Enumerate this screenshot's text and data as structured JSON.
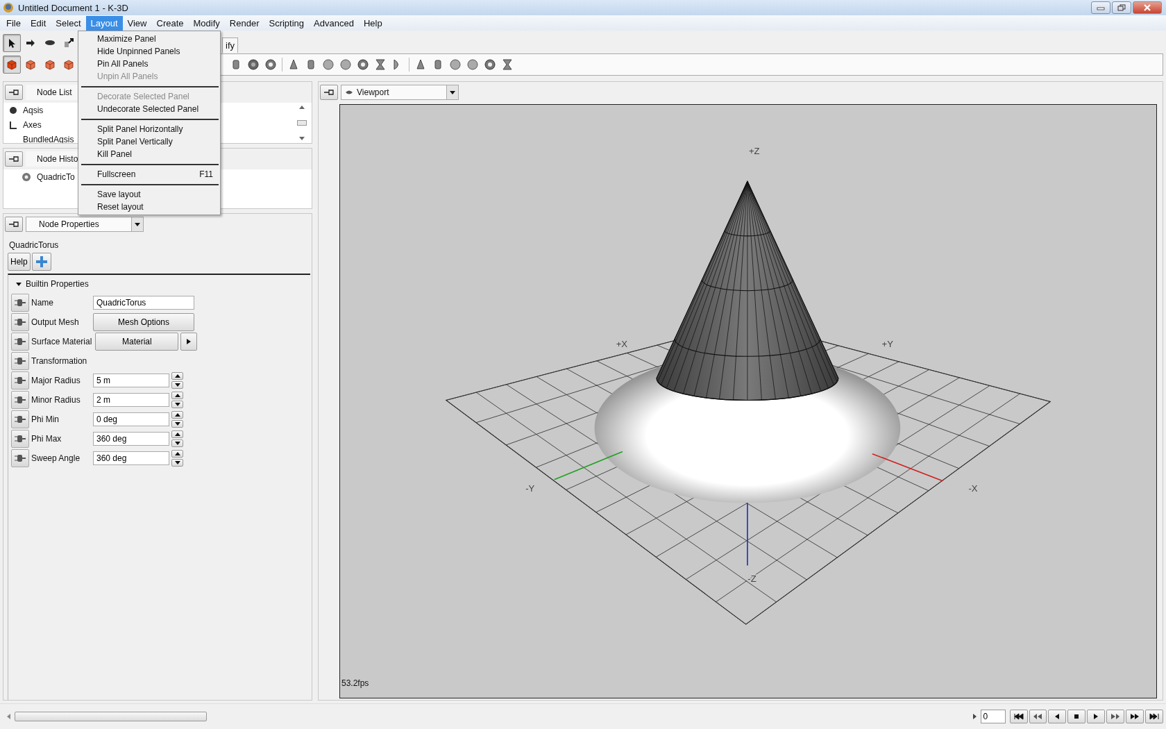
{
  "window": {
    "title": "Untitled Document 1 - K-3D"
  },
  "menu_bar": [
    {
      "label": "File",
      "selected": false
    },
    {
      "label": "Edit",
      "selected": false
    },
    {
      "label": "Select",
      "selected": false
    },
    {
      "label": "Layout",
      "selected": true
    },
    {
      "label": "View",
      "selected": false
    },
    {
      "label": "Create",
      "selected": false
    },
    {
      "label": "Modify",
      "selected": false
    },
    {
      "label": "Render",
      "selected": false
    },
    {
      "label": "Scripting",
      "selected": false
    },
    {
      "label": "Advanced",
      "selected": false
    },
    {
      "label": "Help",
      "selected": false
    }
  ],
  "layout_menu": [
    {
      "kind": "item",
      "label": "Maximize Panel",
      "disabled": false
    },
    {
      "kind": "item",
      "label": "Hide Unpinned Panels",
      "disabled": false
    },
    {
      "kind": "item",
      "label": "Pin All Panels",
      "disabled": false
    },
    {
      "kind": "item",
      "label": "Unpin All Panels",
      "disabled": true
    },
    {
      "kind": "separator"
    },
    {
      "kind": "item",
      "label": "Decorate Selected Panel",
      "disabled": true
    },
    {
      "kind": "item",
      "label": "Undecorate Selected Panel",
      "disabled": false
    },
    {
      "kind": "separator"
    },
    {
      "kind": "item",
      "label": "Split Panel Horizontally",
      "disabled": false
    },
    {
      "kind": "item",
      "label": "Split Panel Vertically",
      "disabled": false
    },
    {
      "kind": "item",
      "label": "Kill Panel",
      "disabled": false
    },
    {
      "kind": "separator"
    },
    {
      "kind": "item",
      "label": "Fullscreen",
      "shortcut": "F11",
      "disabled": false
    },
    {
      "kind": "separator"
    },
    {
      "kind": "item",
      "label": "Save layout",
      "disabled": false
    },
    {
      "kind": "item",
      "label": "Reset layout",
      "disabled": false
    }
  ],
  "toolbar": {
    "tab_label": "ify",
    "tools": [
      {
        "selected": true
      },
      {
        "selected": false
      },
      {
        "selected": false
      },
      {
        "selected": false
      }
    ],
    "mesh_tools": [
      {
        "selected": true
      },
      {
        "selected": false
      },
      {
        "selected": false
      },
      {
        "selected": false
      }
    ]
  },
  "node_list": {
    "title": "Node List",
    "items": [
      "Aqsis",
      "Axes",
      "BundledAqsis"
    ]
  },
  "node_history": {
    "title": "Node Histo",
    "items": [
      "QuadricTo"
    ]
  },
  "node_properties": {
    "title": "Node Properties",
    "node_name": "QuadricTorus",
    "help_button": "Help",
    "section": {
      "label": "Builtin Properties",
      "expanded": true
    },
    "properties": [
      {
        "kind": "text",
        "label": "Name",
        "value": "QuadricTorus"
      },
      {
        "kind": "button",
        "label": "Output Mesh",
        "button": "Mesh Options"
      },
      {
        "kind": "menu",
        "label": "Surface Material",
        "button": "Material"
      },
      {
        "kind": "plain",
        "label": "Transformation"
      },
      {
        "kind": "spin",
        "label": "Major Radius",
        "value": "5 m"
      },
      {
        "kind": "spin",
        "label": "Minor Radius",
        "value": "2 m"
      },
      {
        "kind": "spin",
        "label": "Phi Min",
        "value": "0 deg"
      },
      {
        "kind": "spin",
        "label": "Phi Max",
        "value": "360 deg"
      },
      {
        "kind": "spin",
        "label": "Sweep Angle",
        "value": "360 deg"
      }
    ]
  },
  "viewport": {
    "title": "Viewport",
    "axis_labels": [
      "+Z",
      "+X",
      "+Y",
      "-Y",
      "-X",
      "-Z"
    ],
    "fps": "53.2fps"
  },
  "timeline": {
    "frame": "0"
  }
}
